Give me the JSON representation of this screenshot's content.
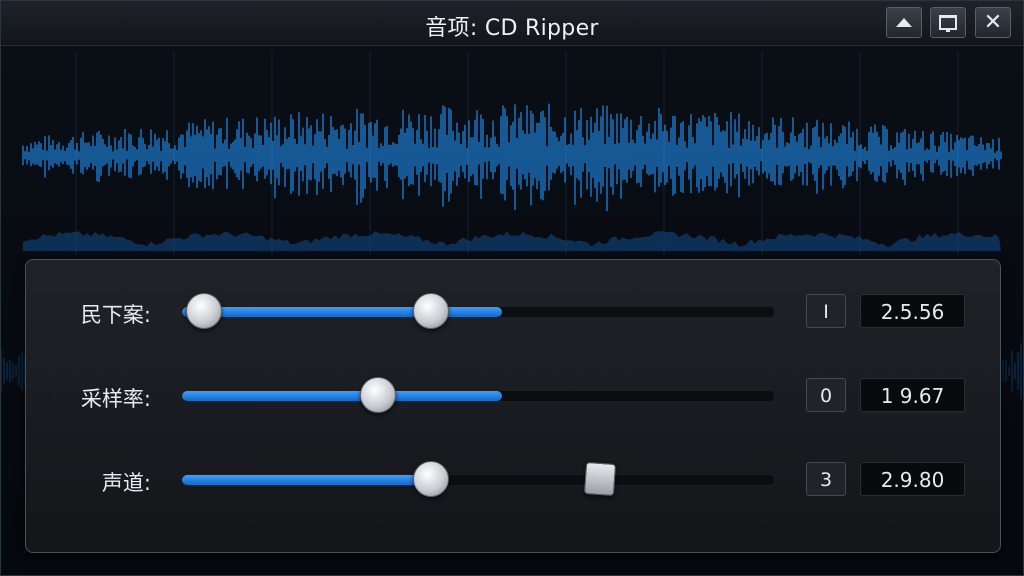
{
  "window": {
    "title": "音项: CD Ripper"
  },
  "controls": {
    "up_icon": "triangle-up-icon",
    "max_icon": "maximize-icon",
    "close_icon": "close-icon",
    "close_glyph": "✕"
  },
  "settings": {
    "rows": [
      {
        "label": "民下案:",
        "small": "I",
        "value": "2.5.56",
        "fill": 0.54,
        "knob1": 0.04,
        "knob2": 0.42
      },
      {
        "label": "采样率:",
        "small": "0",
        "value": "1 9.67",
        "fill": 0.54,
        "knob1": 0.33
      },
      {
        "label": "声道:",
        "small": "3",
        "value": "2.9.80",
        "fill": 0.42,
        "knob1": 0.42,
        "knob2": 0.71
      }
    ]
  },
  "colors": {
    "accent": "#2b8ae6",
    "waveform": "#1f7fd6"
  }
}
